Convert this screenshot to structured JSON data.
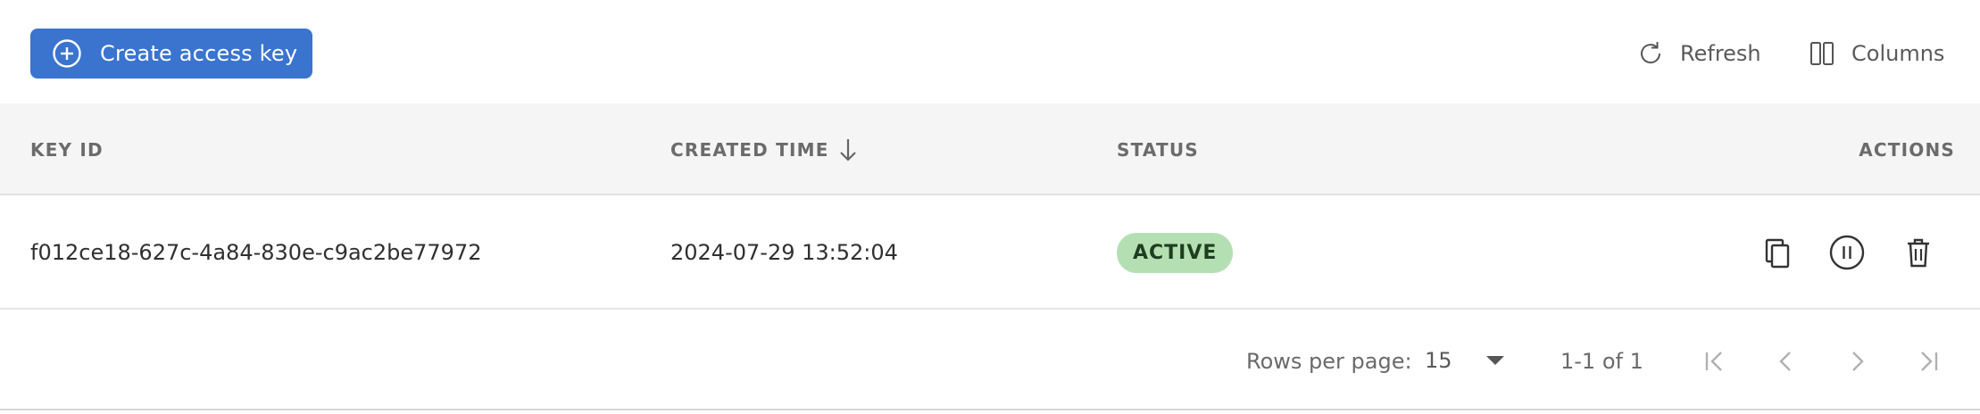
{
  "toolbar": {
    "create_label": "Create access key",
    "refresh_label": "Refresh",
    "columns_label": "Columns"
  },
  "table": {
    "columns": [
      "KEY ID",
      "CREATED TIME",
      "STATUS",
      "ACTIONS"
    ],
    "sort": {
      "column": "CREATED TIME",
      "direction": "descending"
    },
    "rows": [
      {
        "key_id": "f012ce18-627c-4a84-830e-c9ac2be77972",
        "created_time": "2024-07-29 13:52:04",
        "status": "ACTIVE"
      }
    ]
  },
  "pagination": {
    "rows_per_page_label": "Rows per page:",
    "rows_per_page_value": "15",
    "range_text": "1-1 of 1"
  },
  "colors": {
    "primary": "#3a74cf",
    "active_badge_bg": "#b4dfb3",
    "header_bg": "#f5f5f5"
  },
  "icons": [
    "add-circle-icon",
    "refresh-icon",
    "columns-icon",
    "arrow-down-icon",
    "copy-icon",
    "pause-circle-icon",
    "trash-icon",
    "first-page-icon",
    "chevron-left-icon",
    "chevron-right-icon",
    "last-page-icon"
  ]
}
